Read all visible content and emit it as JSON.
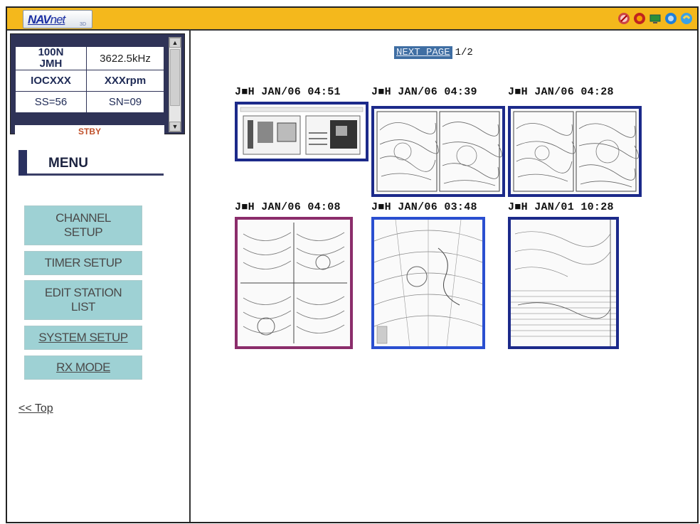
{
  "app": {
    "logo_nav": "NAV",
    "logo_net": "net",
    "logo_sub": "3D"
  },
  "toolbar_icons": [
    "alert-icon",
    "stop-icon",
    "monitor-icon",
    "globe-icon",
    "help-icon"
  ],
  "status": {
    "station": "100N\nJMH",
    "frequency": "3622.5kHz",
    "ioc": "IOCXXX",
    "rpm": "XXXrpm",
    "ss": "SS=56",
    "sn": "SN=09",
    "mode": "STBY"
  },
  "menu": {
    "title": "MENU",
    "items": [
      {
        "label": "CHANNEL\nSETUP"
      },
      {
        "label": "TIMER SETUP"
      },
      {
        "label": "EDIT STATION\nLIST"
      },
      {
        "label": "SYSTEM SETUP"
      },
      {
        "label": "RX MODE"
      }
    ],
    "top_link": "<< Top"
  },
  "pager": {
    "next_label": "NEXT PAGE",
    "page": "1/2"
  },
  "thumbnails": [
    {
      "caption": "J■H JAN/06 04:51"
    },
    {
      "caption": "J■H JAN/06 04:39"
    },
    {
      "caption": "J■H JAN/06 04:28"
    },
    {
      "caption": "J■H JAN/06 04:08"
    },
    {
      "caption": "J■H JAN/06 03:48"
    },
    {
      "caption": "J■H JAN/01 10:28"
    }
  ],
  "colors": {
    "topbar": "#f4b81c",
    "status_panel": "#2f3357",
    "menu_button": "#9ed1d4",
    "thumb_border": "#1c2a8a"
  }
}
